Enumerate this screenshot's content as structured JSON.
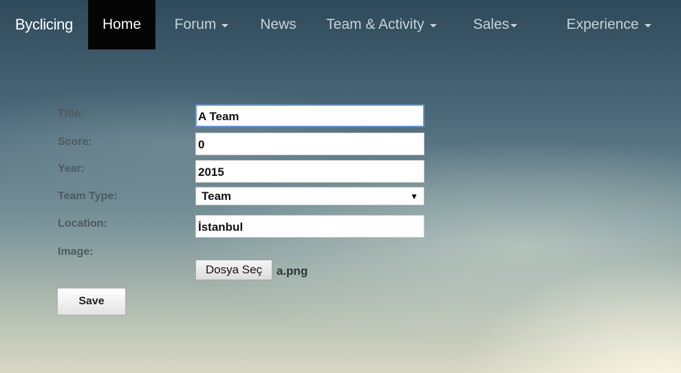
{
  "navbar": {
    "brand": "Byclicing",
    "items": [
      {
        "label": "Home",
        "active": true,
        "dropdown": false
      },
      {
        "label": "Forum",
        "dropdown": true
      },
      {
        "label": "News",
        "dropdown": false
      },
      {
        "label": "Team & Activity",
        "dropdown": true
      },
      {
        "label": "Sales",
        "dropdown": true
      },
      {
        "label": "Experience",
        "dropdown": true
      }
    ]
  },
  "form": {
    "title_label": "Title:",
    "title_value": "A Team",
    "score_label": "Score:",
    "score_value": "0",
    "year_label": "Year:",
    "year_value": "2015",
    "team_type_label": "Team Type:",
    "team_type_value": "Team",
    "location_label": "Location:",
    "location_value": "İstanbul",
    "image_label": "Image:",
    "file_button_label": "Dosya Seç",
    "file_name": "a.png",
    "save_label": "Save"
  },
  "colors": {
    "navbar_active_bg": "#050505",
    "nav_text": "#c9d2d6",
    "focus_border": "#6f95d4"
  }
}
